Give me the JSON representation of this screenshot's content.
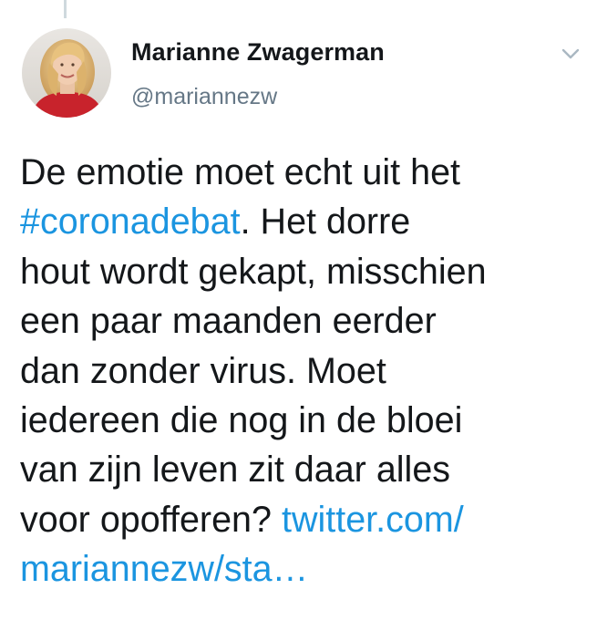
{
  "tweet": {
    "author": {
      "display_name": "Marianne Zwagerman",
      "handle": "@mariannezw"
    },
    "lines": [
      {
        "text": "De emotie moet echt uit het"
      },
      {
        "hashtag": "#coronadebat",
        "text": ". Het dorre"
      },
      {
        "text": "hout wordt gekapt, misschien"
      },
      {
        "text": "een paar maanden eerder"
      },
      {
        "text": "dan zonder virus. Moet"
      },
      {
        "text": "iedereen die nog in de bloei"
      },
      {
        "text": "van zijn leven zit daar alles"
      },
      {
        "text": "voor opofferen? ",
        "link": "twitter.com/"
      },
      {
        "link": "mariannezw/sta…"
      }
    ]
  },
  "icons": {
    "caret": "chevron-down-icon"
  },
  "colors": {
    "text": "#14171a",
    "secondary": "#657786",
    "link": "#1b95e0",
    "thread_line": "#cfd9de",
    "background": "#ffffff"
  }
}
